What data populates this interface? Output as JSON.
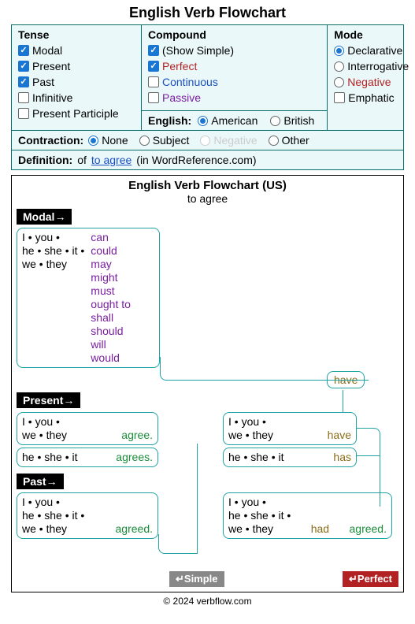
{
  "title": "English Verb Flowchart",
  "settings": {
    "tense": {
      "heading": "Tense",
      "modal": "Modal",
      "present": "Present",
      "past": "Past",
      "infinitive": "Infinitive",
      "present_participle": "Present Participle"
    },
    "compound": {
      "heading": "Compound",
      "show_simple": "(Show Simple)",
      "perfect": "Perfect",
      "continuous": "Continuous",
      "passive": "Passive"
    },
    "mode": {
      "heading": "Mode",
      "declarative": "Declarative",
      "interrogative": "Interrogative",
      "negative": "Negative",
      "emphatic": "Emphatic"
    },
    "english": {
      "label": "English:",
      "american": "American",
      "british": "British"
    },
    "contraction": {
      "label": "Contraction:",
      "none": "None",
      "subject": "Subject",
      "negative": "Negative",
      "other": "Other"
    },
    "definition": {
      "label": "Definition:",
      "of": "of",
      "verb_link": "to agree",
      "suffix": "(in WordReference.com)"
    }
  },
  "flowchart": {
    "title": "English Verb Flowchart (US)",
    "verb": "to agree",
    "labels": {
      "modal": "Modal→",
      "present": "Present→",
      "past": "Past→"
    },
    "pronouns": {
      "all": "I • you •\nhe • she • it •\nwe • they",
      "non3sg": "I • you •\nwe • they",
      "third_sg": "he • she • it"
    },
    "modals": "can\ncould\nmay\nmight\nmust\nought to\nshall\nshould\nwill\nwould",
    "words": {
      "agree": "agree.",
      "agrees": "agrees.",
      "agreed": "agreed.",
      "have": "have",
      "has": "has",
      "had": "had"
    },
    "tags": {
      "simple": "↵Simple",
      "perfect": "↵Perfect"
    }
  },
  "footer": "© 2024 verbflow.com"
}
